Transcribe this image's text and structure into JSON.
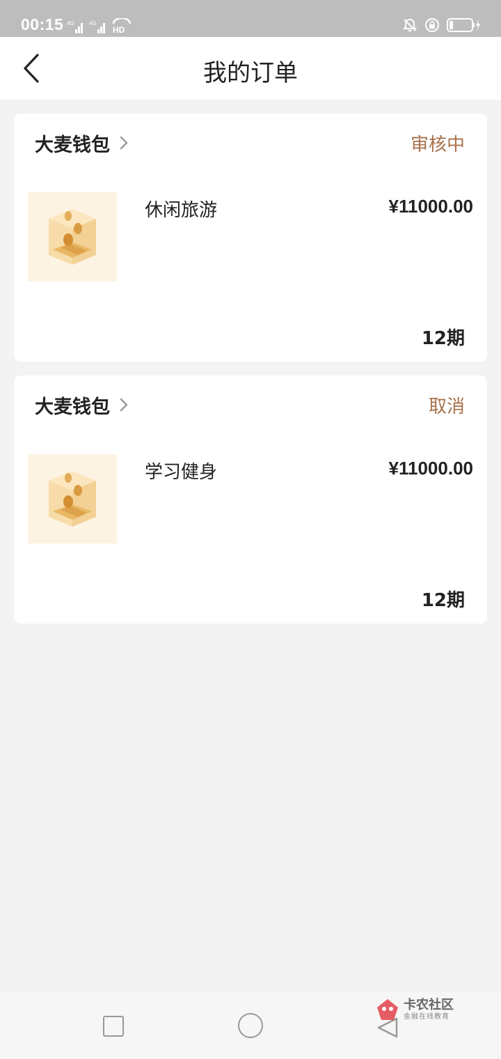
{
  "status_bar": {
    "time": "00:15",
    "network_1": "4G",
    "network_2": "4G",
    "hd_badge": "HD",
    "icons": [
      "notifications-off-icon",
      "lock-rotation-icon",
      "battery-charging-icon"
    ]
  },
  "header": {
    "title": "我的订单",
    "back_icon": "chevron-left-icon"
  },
  "orders": [
    {
      "merchant": "大麦钱包",
      "status": "审核中",
      "product": "休闲旅游",
      "price": "¥11000.00",
      "term": "12期"
    },
    {
      "merchant": "大麦钱包",
      "status": "取消",
      "product": "学习健身",
      "price": "¥11000.00",
      "term": "12期"
    }
  ],
  "colors": {
    "status_text": "#a8714a",
    "background": "#f3f3f3",
    "card": "#ffffff",
    "status_bar": "#bdbdbd"
  },
  "system_nav": {
    "buttons": [
      "recent-apps-button",
      "home-button",
      "back-button"
    ]
  },
  "watermark": {
    "title": "卡农社区",
    "subtitle": "金融在线教育"
  }
}
